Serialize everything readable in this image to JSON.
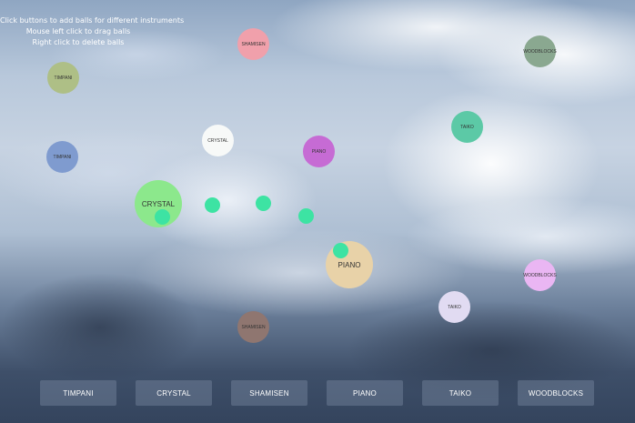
{
  "instructions": {
    "line1": "Click buttons to add balls for different instruments",
    "line2": "Mouse left click to drag balls",
    "line3": "Right click to delete balls"
  },
  "colors": {
    "note_dot": "#3de3a3",
    "button_background": "rgba(120,135,160,0.45)"
  },
  "balls": [
    {
      "label": "SHAMISEN",
      "color": "#f0a0ab"
    },
    {
      "label": "WOODBLOCKS",
      "color": "#8aa890"
    },
    {
      "label": "TIMPANI",
      "color": "#aebf86"
    },
    {
      "label": "TAIKO",
      "color": "#5cc9a6"
    },
    {
      "label": "CRYSTAL",
      "color": "#f7f9f8"
    },
    {
      "label": "PIANO",
      "color": "#c66bd4"
    },
    {
      "label": "TIMPANI",
      "color": "#7f9bcf"
    },
    {
      "label": "CRYSTAL",
      "color": "#8ce88c"
    },
    {
      "label": "PIANO",
      "color": "#e8d2a8"
    },
    {
      "label": "WOODBLOCKS",
      "color": "#eab6f3"
    },
    {
      "label": "TAIKO",
      "color": "#e1dbf2"
    },
    {
      "label": "SHAMISEN",
      "color": "#8f7670"
    }
  ],
  "toolbar": {
    "buttons": [
      "TIMPANI",
      "CRYSTAL",
      "SHAMISEN",
      "PIANO",
      "TAIKO",
      "WOODBLOCKS"
    ]
  }
}
